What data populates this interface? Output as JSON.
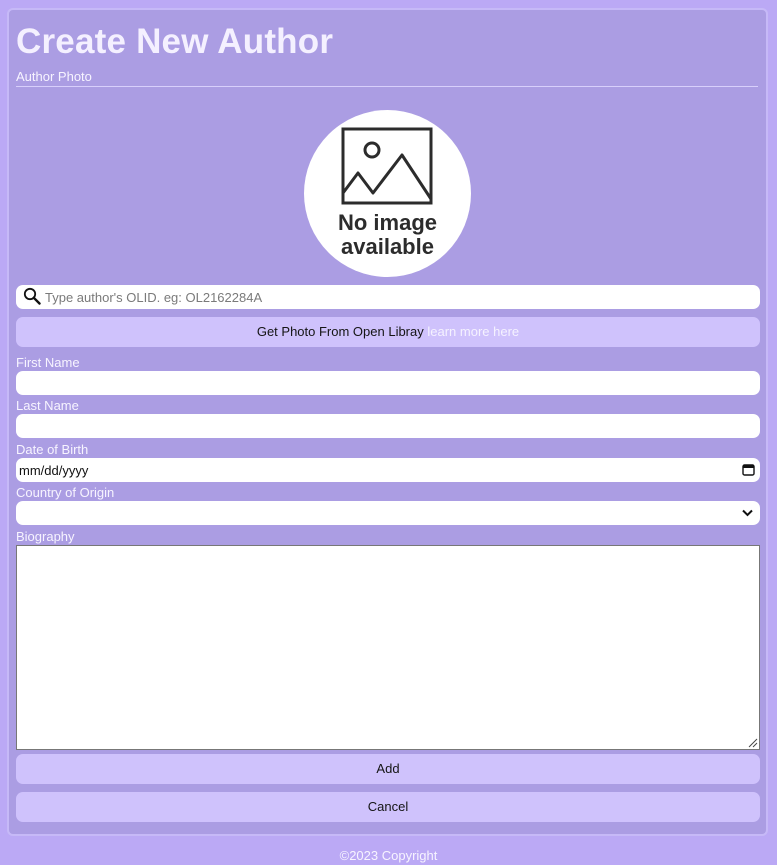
{
  "page": {
    "title": "Create New Author",
    "photo_label": "Author Photo"
  },
  "photo": {
    "placeholder_line1": "No image",
    "placeholder_line2": "available"
  },
  "search": {
    "placeholder": "Type author's OLID. eg: OL2162284A",
    "icon": "search-icon"
  },
  "get_photo": {
    "label": "Get Photo From Open Libray",
    "link_text": "learn more here"
  },
  "form": {
    "first_name_label": "First Name",
    "first_name_value": "",
    "last_name_label": "Last Name",
    "last_name_value": "",
    "dob_label": "Date of Birth",
    "dob_value": "mm/dd/yyyy",
    "country_label": "Country of Origin",
    "country_value": "",
    "bio_label": "Biography",
    "bio_value": ""
  },
  "actions": {
    "add_label": "Add",
    "cancel_label": "Cancel"
  },
  "footer": {
    "copyright": "©2023 Copyright"
  },
  "colors": {
    "page_bg": "#bba9f5",
    "card_bg": "#ab9de3",
    "button_bg": "#cfc2fc"
  }
}
